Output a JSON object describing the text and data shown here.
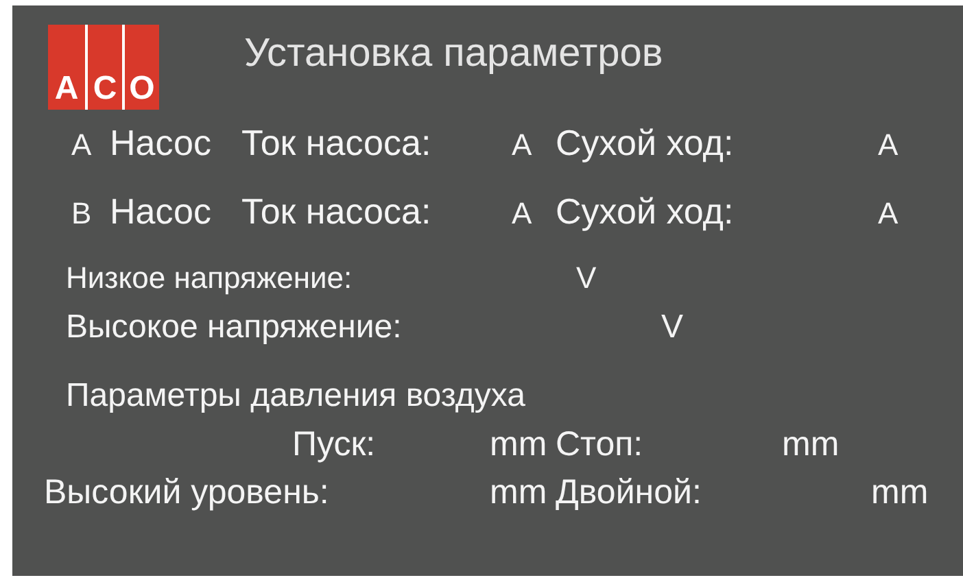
{
  "logo": {
    "letters": [
      "A",
      "C",
      "O"
    ]
  },
  "title": "Установка параметров",
  "pumps": [
    {
      "letter": "А",
      "name": "Насос",
      "current_label": "Ток насоса:",
      "current_unit": "А",
      "dry_run_label": "Сухой ход:",
      "dry_run_unit": "А"
    },
    {
      "letter": "В",
      "name": "Насос",
      "current_label": "Ток насоса:",
      "current_unit": "А",
      "dry_run_label": "Сухой ход:",
      "dry_run_unit": "А"
    }
  ],
  "voltage": [
    {
      "label": "Низкое напряжение:",
      "unit": "V"
    },
    {
      "label": "Высокое напряжение:",
      "unit": "V"
    }
  ],
  "air_pressure": {
    "heading": "Параметры давления воздуха",
    "rows": [
      [
        {
          "label": "Пуск:",
          "unit": "mm"
        },
        {
          "label": "Стоп:",
          "unit": "mm"
        }
      ],
      [
        {
          "label": "Высокий уровень:",
          "unit": "mm"
        },
        {
          "label": "Двойной:",
          "unit": "mm"
        }
      ]
    ]
  }
}
